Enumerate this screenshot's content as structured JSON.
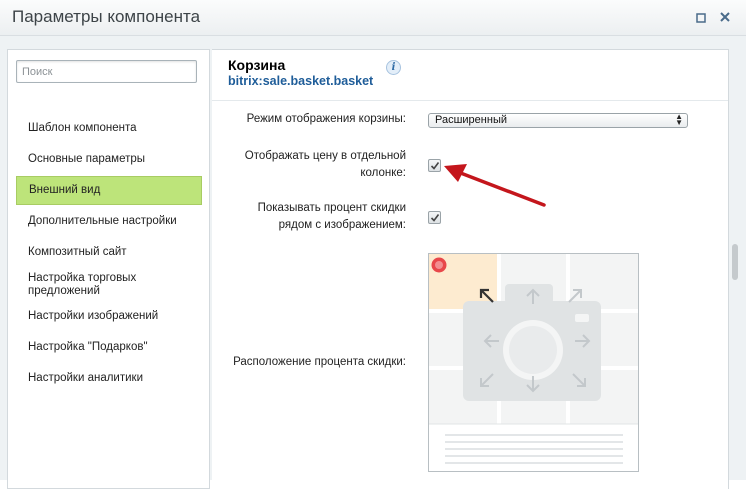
{
  "window": {
    "title": "Параметры компонента",
    "maximize_icon": "maximize-icon",
    "close_icon": "close-icon"
  },
  "sidebar": {
    "search_placeholder": "Поиск",
    "items": [
      {
        "label": "Шаблон компонента",
        "active": false
      },
      {
        "label": "Основные параметры",
        "active": false
      },
      {
        "label": "Внешний вид",
        "active": true
      },
      {
        "label": "Дополнительные настройки",
        "active": false
      },
      {
        "label": "Композитный сайт",
        "active": false
      },
      {
        "label": "Настройка торговых предложений",
        "active": false
      },
      {
        "label": "Настройки изображений",
        "active": false
      },
      {
        "label": "Настройка \"Подарков\"",
        "active": false
      },
      {
        "label": "Настройки аналитики",
        "active": false
      }
    ],
    "active_color": "#bde47a"
  },
  "component": {
    "title": "Корзина",
    "code": "bitrix:sale.basket.basket",
    "info_icon": "info-icon"
  },
  "params": {
    "display_mode_label": "Режим отображения корзины:",
    "display_mode_value": "Расширенный",
    "price_column_label_1": "Отображать цену в отдельной",
    "price_column_label_2": "колонке:",
    "price_column_checked": true,
    "discount_percent_label_1": "Показывать процент скидки",
    "discount_percent_label_2": "рядом с изображением:",
    "discount_percent_checked": true,
    "discount_position_label": "Расположение процента скидки:",
    "discount_position_selected": "top-left"
  },
  "colors": {
    "annotation_arrow": "#c4161c",
    "link": "#1f5d99",
    "selected_cell": "#fdebd0",
    "marker": "#e8474a"
  }
}
